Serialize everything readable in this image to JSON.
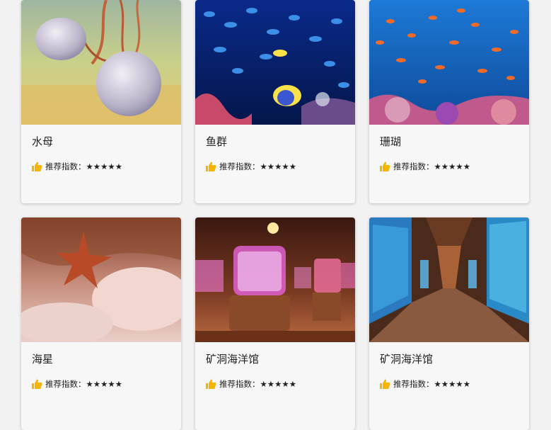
{
  "cards": [
    {
      "title": "水母",
      "rating_label": "推荐指数：",
      "stars": "★★★★★",
      "image": "jellyfish-photo"
    },
    {
      "title": "鱼群",
      "rating_label": "推荐指数：",
      "stars": "★★★★★",
      "image": "fish-school-photo"
    },
    {
      "title": "珊瑚",
      "rating_label": "推荐指数：",
      "stars": "★★★★★",
      "image": "coral-reef-photo"
    },
    {
      "title": "海星",
      "rating_label": "推荐指数：",
      "stars": "★★★★★",
      "image": "starfish-photo"
    },
    {
      "title": "矿洞海洋馆",
      "rating_label": "推荐指数：",
      "stars": "★★★★★",
      "image": "cave-aquarium-photo"
    },
    {
      "title": "矿洞海洋馆",
      "rating_label": "推荐指数：",
      "stars": "★★★★★",
      "image": "aquarium-tunnel-photo"
    }
  ],
  "colors": {
    "thumbs_up": "#f5b400",
    "background": "#f2f2f2",
    "card": "#f7f7f7"
  }
}
